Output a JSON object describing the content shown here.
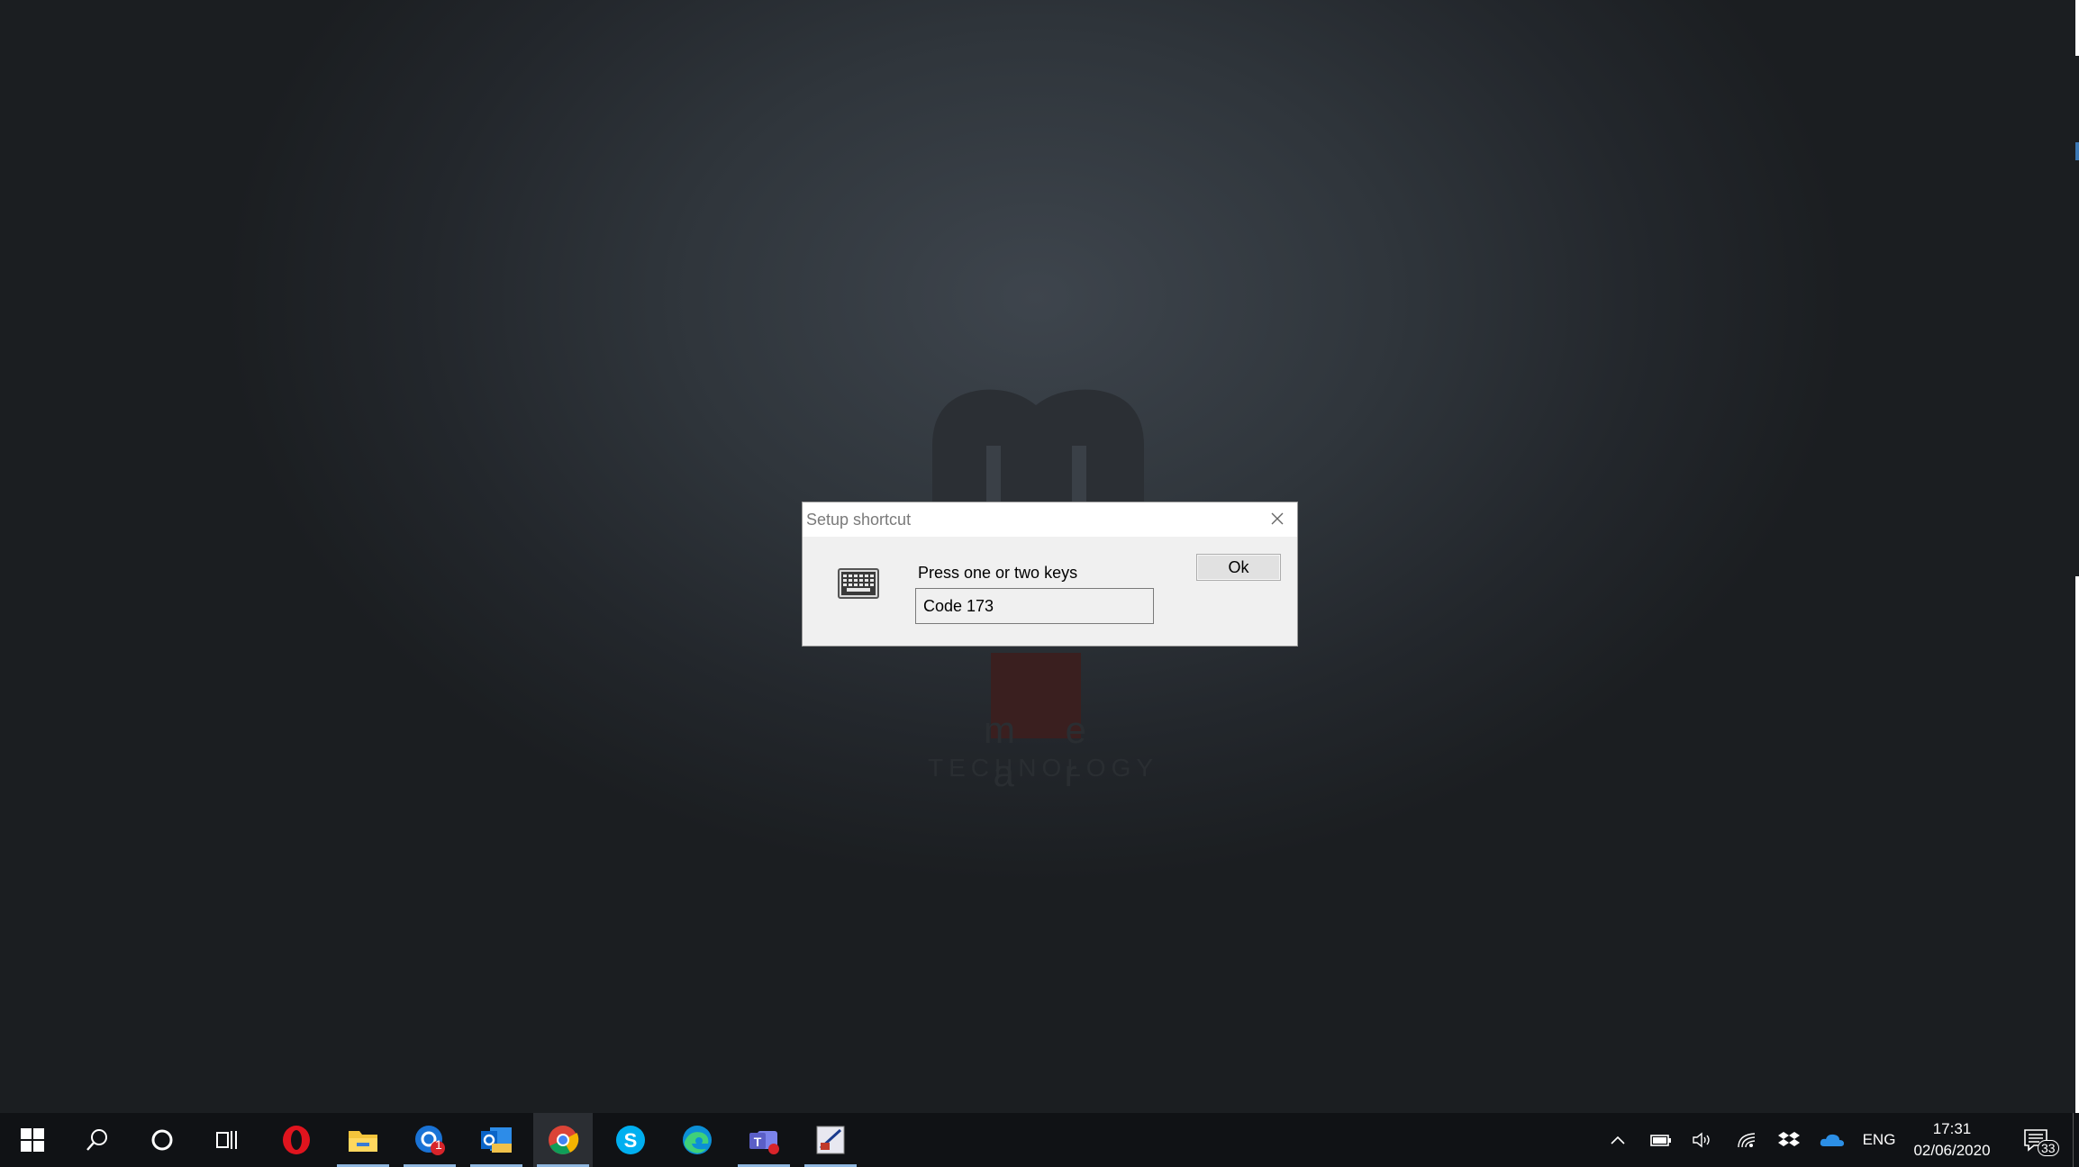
{
  "dialog": {
    "title": "Setup shortcut",
    "prompt": "Press one or two keys",
    "key_field_value": "Code 173",
    "ok_label": "Ok"
  },
  "wallpaper": {
    "brand_word": "m e a r",
    "brand_sub": "TECHNOLOGY"
  },
  "taskbar": {
    "pinned": [
      {
        "name": "opera",
        "icon": "opera-icon"
      },
      {
        "name": "file-explorer",
        "icon": "folder-icon"
      },
      {
        "name": "mail-app",
        "icon": "mail-icon",
        "badge": "1"
      },
      {
        "name": "outlook",
        "icon": "outlook-icon"
      },
      {
        "name": "chrome",
        "icon": "chrome-icon"
      },
      {
        "name": "skype",
        "icon": "skype-icon"
      },
      {
        "name": "edge",
        "icon": "edge-icon"
      },
      {
        "name": "teams",
        "icon": "teams-icon"
      },
      {
        "name": "setup-app",
        "icon": "app-icon"
      }
    ],
    "tray": {
      "language": "ENG",
      "time": "17:31",
      "date": "02/06/2020",
      "notification_count": "33"
    }
  },
  "colors": {
    "taskbar_bg": "#101215",
    "accent_underline": "#8fb6de",
    "opera_red": "#e0141e",
    "outlook_blue": "#0a64c8",
    "skype_blue": "#00aff0",
    "teams_purple": "#5b5fc7"
  }
}
